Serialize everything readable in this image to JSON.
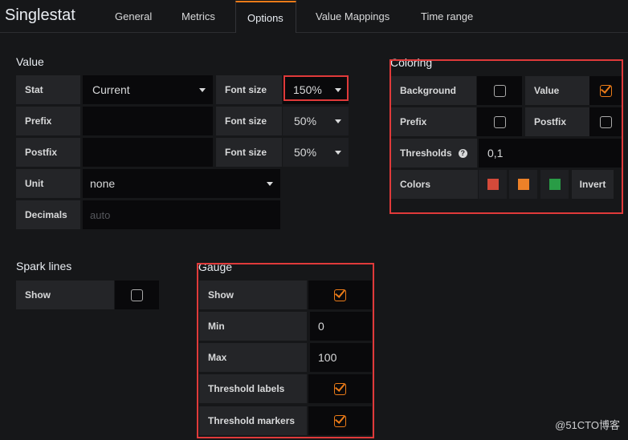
{
  "header": {
    "title": "Singlestat"
  },
  "tabs": [
    {
      "label": "General"
    },
    {
      "label": "Metrics"
    },
    {
      "label": "Options"
    },
    {
      "label": "Value Mappings"
    },
    {
      "label": "Time range"
    }
  ],
  "value_section": {
    "title": "Value",
    "stat_label": "Stat",
    "stat_value": "Current",
    "prefix_label": "Prefix",
    "prefix_value": "",
    "postfix_label": "Postfix",
    "postfix_value": "",
    "font_size_label": "Font size",
    "value_font_size": "150%",
    "prefix_font_size": "50%",
    "postfix_font_size": "50%",
    "unit_label": "Unit",
    "unit_value": "none",
    "decimals_label": "Decimals",
    "decimals_placeholder": "auto"
  },
  "coloring": {
    "title": "Coloring",
    "background_label": "Background",
    "background_checked": false,
    "value_label": "Value",
    "value_checked": true,
    "prefix_label": "Prefix",
    "prefix_checked": false,
    "postfix_label": "Postfix",
    "postfix_checked": false,
    "thresholds_label": "Thresholds",
    "thresholds_value": "0,1",
    "colors_label": "Colors",
    "colors": [
      "#d44a3a",
      "#ed8128",
      "#299c46"
    ],
    "invert_label": "Invert"
  },
  "spark_lines": {
    "title": "Spark lines",
    "show_label": "Show",
    "show_checked": false
  },
  "gauge": {
    "title": "Gauge",
    "show_label": "Show",
    "show_checked": true,
    "min_label": "Min",
    "min_value": "0",
    "max_label": "Max",
    "max_value": "100",
    "threshold_labels_label": "Threshold labels",
    "threshold_labels_checked": true,
    "threshold_markers_label": "Threshold markers",
    "threshold_markers_checked": true
  },
  "watermark": "@51CTO博客",
  "theme": {
    "accent": "#eb7b18",
    "highlight": "#e03a3a"
  }
}
